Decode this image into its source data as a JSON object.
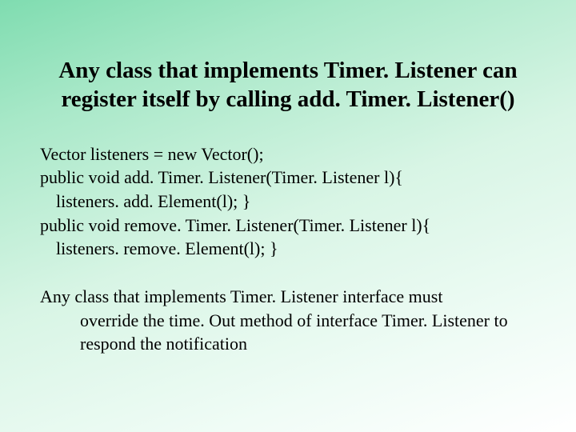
{
  "title_line1": "Any class that implements Timer. Listener can",
  "title_line2": "register itself by calling add. Timer. Listener()",
  "code": {
    "l1": "Vector listeners = new Vector();",
    "l2": "public void add. Timer. Listener(Timer. Listener l){",
    "l3": "listeners. add. Element(l); }",
    "l4": "public void remove. Timer. Listener(Timer. Listener l){",
    "l5": "listeners. remove. Element(l); }"
  },
  "note": {
    "l1": "Any class that implements Timer. Listener interface must",
    "l2": "override the time. Out method of interface Timer. Listener to",
    "l3": "respond  the notification"
  }
}
